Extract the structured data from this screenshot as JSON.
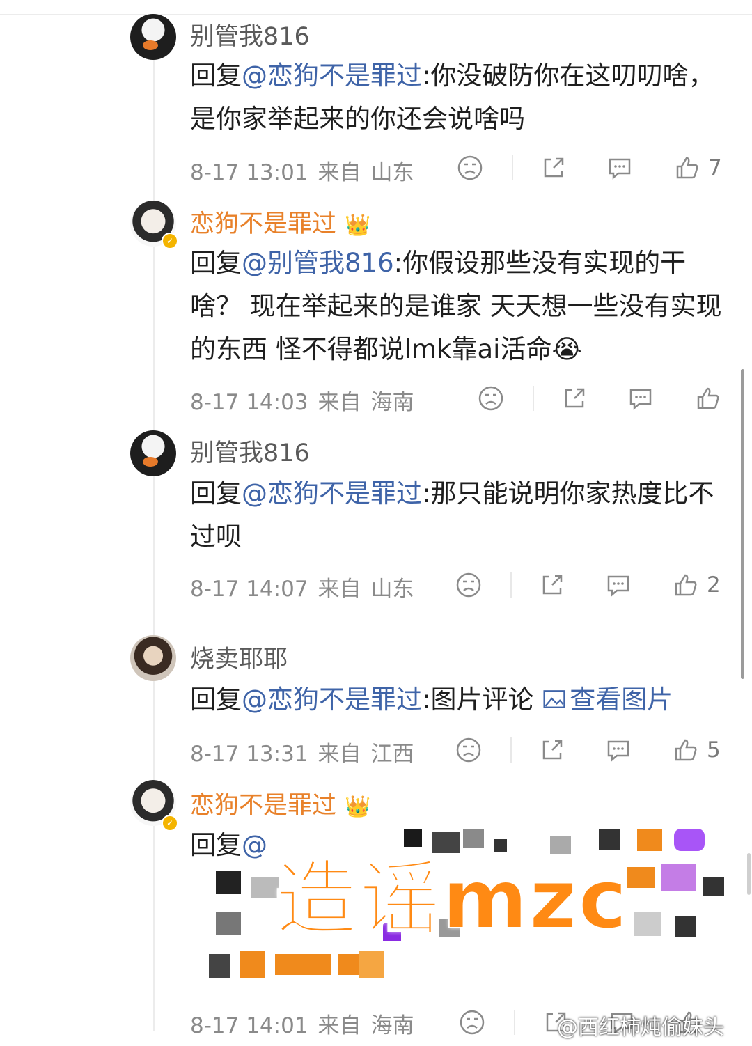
{
  "comments": [
    {
      "name": "别管我816",
      "reply_prefix": "回复",
      "mention": "@恋狗不是罪过",
      "text": ":你没破防你在这叨叨啥，是你家举起来的你还会说啥吗",
      "time": "8-17 13:01",
      "from": "来自",
      "location": "山东",
      "likes": "7"
    },
    {
      "name": "恋狗不是罪过",
      "reply_prefix": "回复",
      "mention": "@别管我816",
      "text": ":你假设那些没有实现的干啥？ 现在举起来的是谁家 天天想一些没有实现的东西 怪不得都说lmk靠ai活命😭",
      "time": "8-17 14:03",
      "from": "来自",
      "location": "海南",
      "likes": ""
    },
    {
      "name": "别管我816",
      "reply_prefix": "回复",
      "mention": "@恋狗不是罪过",
      "text": ":那只能说明你家热度比不过呗",
      "time": "8-17 14:07",
      "from": "来自",
      "location": "山东",
      "likes": "2"
    },
    {
      "name": "烧卖耶耶",
      "reply_prefix": "回复",
      "mention": "@恋狗不是罪过",
      "text": ":图片评论 ",
      "image_link": "查看图片",
      "time": "8-17 13:31",
      "from": "来自",
      "location": "江西",
      "likes": "5"
    },
    {
      "name": "恋狗不是罪过",
      "reply_prefix": "回复",
      "mention": "@",
      "text": "",
      "time": "8-17 14:01",
      "from": "来自",
      "location": "海南",
      "likes": ""
    }
  ],
  "overlay_stamp": "造谣mzc",
  "watermark": "@西红柿炖偷妹头",
  "icons": [
    "dislike-icon",
    "share-icon",
    "comment-icon",
    "like-icon",
    "crown-badge-icon",
    "verified-badge-icon",
    "image-icon"
  ],
  "colors": {
    "mention": "#3f64a8",
    "vip_name": "#e8812a",
    "stamp": "#ff8a14"
  }
}
